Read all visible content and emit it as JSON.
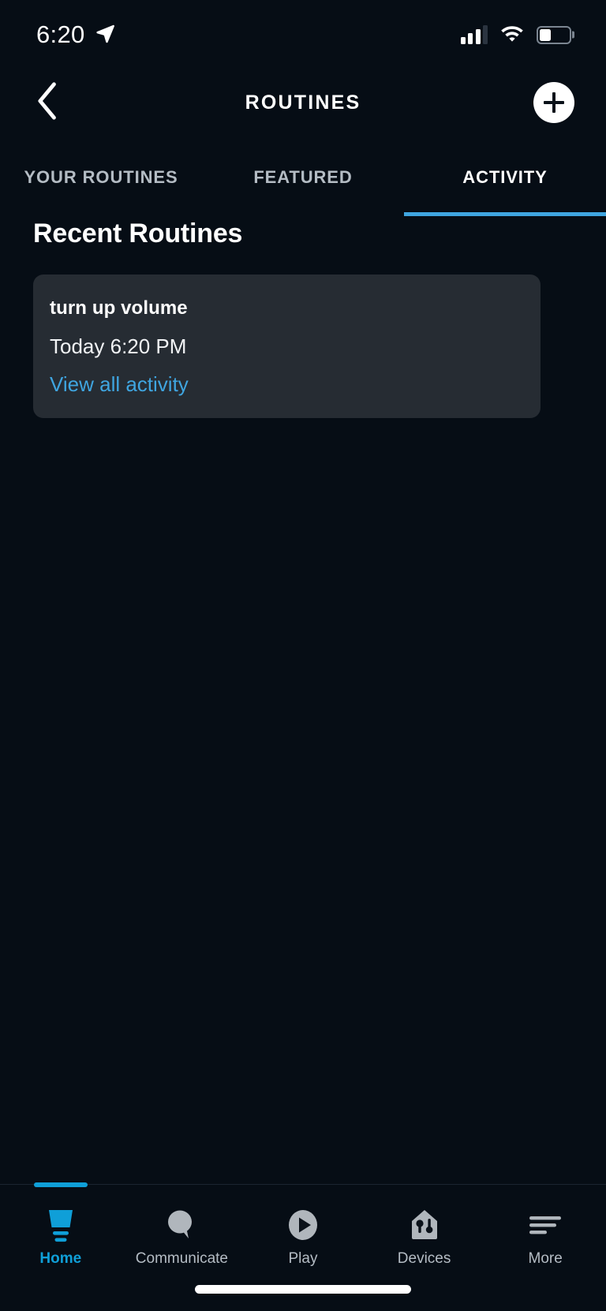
{
  "status_bar": {
    "time": "6:20",
    "location_icon": "location-arrow-icon",
    "cellular_icon": "cellular-signal-icon",
    "cellular_bars_filled": 3,
    "cellular_bars_total": 4,
    "wifi_icon": "wifi-icon",
    "battery_icon": "battery-icon",
    "battery_level_percent": 38
  },
  "header": {
    "back_icon": "chevron-left-icon",
    "title": "ROUTINES",
    "add_icon": "plus-circle-icon"
  },
  "tabs": [
    {
      "label": "YOUR ROUTINES",
      "active": false
    },
    {
      "label": "FEATURED",
      "active": false
    },
    {
      "label": "ACTIVITY",
      "active": true
    }
  ],
  "main": {
    "section_title": "Recent Routines",
    "activity_card": {
      "routine_name": "turn up volume",
      "timestamp": "Today 6:20 PM",
      "link_label": "View all activity"
    }
  },
  "bottom_nav": [
    {
      "label": "Home",
      "icon": "home-speaker-icon",
      "active": true
    },
    {
      "label": "Communicate",
      "icon": "speech-bubble-icon",
      "active": false
    },
    {
      "label": "Play",
      "icon": "play-circle-icon",
      "active": false
    },
    {
      "label": "Devices",
      "icon": "house-devices-icon",
      "active": false
    },
    {
      "label": "More",
      "icon": "hamburger-menu-icon",
      "active": false
    }
  ],
  "colors": {
    "background": "#060d15",
    "card": "#262c33",
    "accent_blue": "#3fa5e0",
    "nav_active_blue": "#0f9fd8",
    "text_primary": "#ffffff",
    "text_muted": "#b4bcc4"
  }
}
